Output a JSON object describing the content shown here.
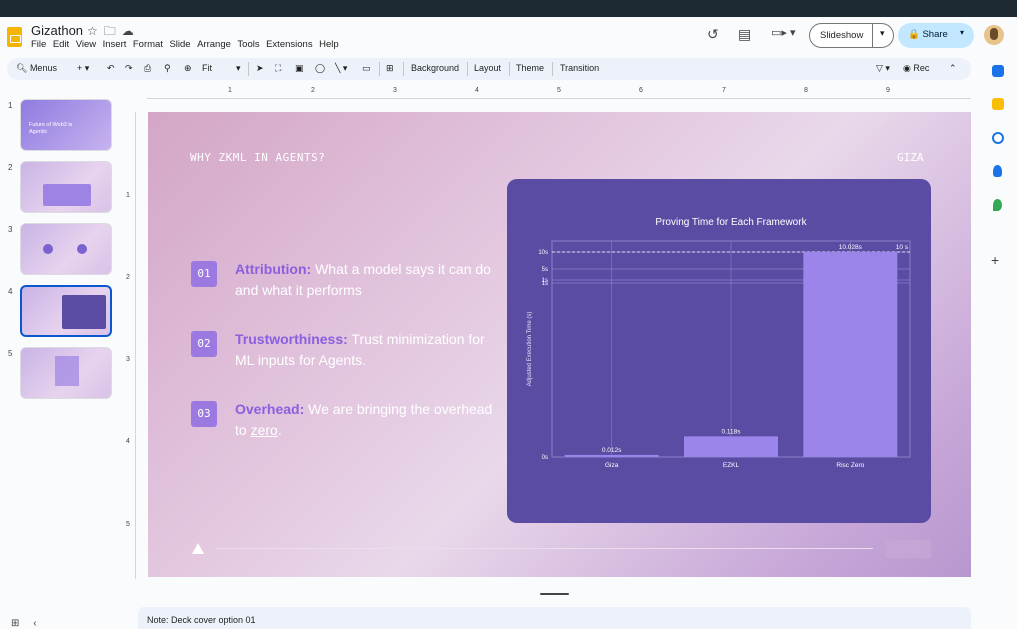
{
  "app": {
    "doc_title": "Gizathon",
    "menu": [
      "File",
      "Edit",
      "View",
      "Insert",
      "Format",
      "Slide",
      "Arrange",
      "Tools",
      "Extensions",
      "Help"
    ],
    "slideshow_label": "Slideshow",
    "share_label": "Share"
  },
  "toolbar": {
    "menus_label": "Menus",
    "zoom_label": "Fit",
    "background_label": "Background",
    "layout_label": "Layout",
    "theme_label": "Theme",
    "transition_label": "Transition",
    "rec_label": "Rec"
  },
  "ruler": {
    "h_marks": [
      "1",
      "2",
      "3",
      "4",
      "5",
      "6",
      "7",
      "8",
      "9"
    ],
    "v_marks": [
      "1",
      "2",
      "3",
      "4",
      "5"
    ]
  },
  "filmstrip": {
    "numbers": [
      "1",
      "2",
      "3",
      "4",
      "5"
    ],
    "slide1_title": "Future of Web3 is Agentic"
  },
  "slide": {
    "heading": "WHY ZKML IN AGENTS?",
    "brand": "GIZA",
    "points": [
      {
        "num": "01",
        "key": "Attribution:",
        "text": " What a model says it can do and what it performs"
      },
      {
        "num": "02",
        "key": "Trustworthiness:",
        "text": " Trust minimization for ML inputs for Agents."
      },
      {
        "num": "03",
        "key": "Overhead:",
        "text": " We are bringing the overhead to ",
        "underlined": "zero",
        "tail": "."
      }
    ]
  },
  "chart_data": {
    "type": "bar",
    "title": "Proving Time for Each Framework",
    "xlabel": "",
    "ylabel": "Adjusted Execution Time (s)",
    "categories": [
      "Giza",
      "EZKL",
      "Risc Zero"
    ],
    "values": [
      0.012,
      0.118,
      10.028
    ],
    "data_labels": [
      "0.012s",
      "0.118s",
      "10.028s"
    ],
    "y_ticks": [
      "0s",
      "1s",
      "1s",
      "5s",
      "10s"
    ],
    "reference_label": "10 s",
    "colors": {
      "card": "#5a4ba3",
      "bar": "#9b84ea",
      "grid": "#8d80c9"
    }
  },
  "notes": {
    "text": "Note: Deck cover option 01"
  }
}
